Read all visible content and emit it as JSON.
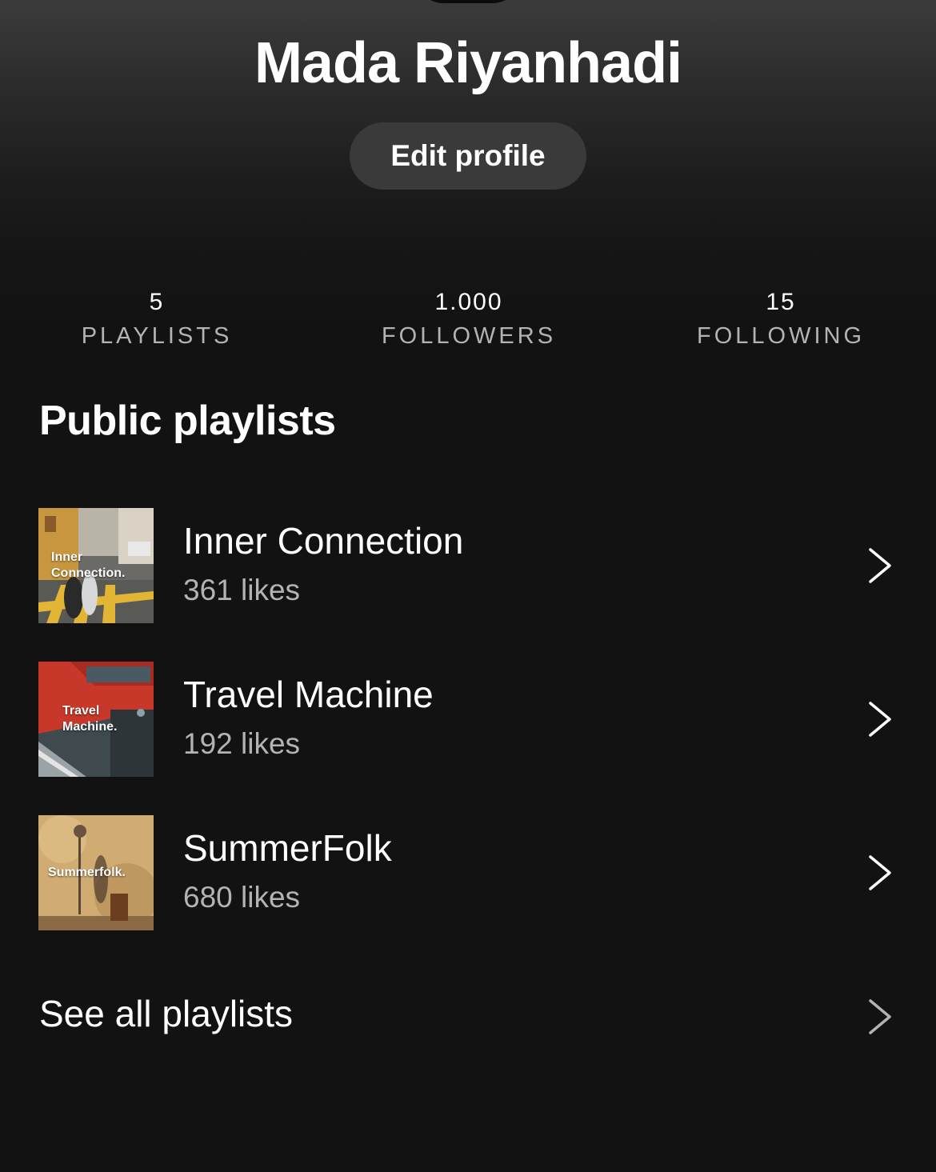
{
  "profile": {
    "name": "Mada Riyanhadi",
    "edit_label": "Edit profile"
  },
  "stats": [
    {
      "value": "5",
      "label": "PLAYLISTS"
    },
    {
      "value": "1.000",
      "label": "FOLLOWERS"
    },
    {
      "value": "15",
      "label": "FOLLOWING"
    }
  ],
  "section": {
    "title": "Public playlists"
  },
  "playlists": [
    {
      "title": "Inner Connection",
      "likes": "361 likes",
      "cover_text_1": "Inner",
      "cover_text_2": "Connection."
    },
    {
      "title": "Travel Machine",
      "likes": "192 likes",
      "cover_text_1": "Travel",
      "cover_text_2": "Machine."
    },
    {
      "title": "SummerFolk",
      "likes": "680 likes",
      "cover_text_1": "Summerfolk.",
      "cover_text_2": ""
    }
  ],
  "see_all": {
    "label": "See all playlists"
  },
  "icons": {
    "chevron": "chevron-right-icon"
  },
  "colors": {
    "background": "#121212",
    "button": "#3a3a3a",
    "secondary_text": "#b3b3b3"
  }
}
